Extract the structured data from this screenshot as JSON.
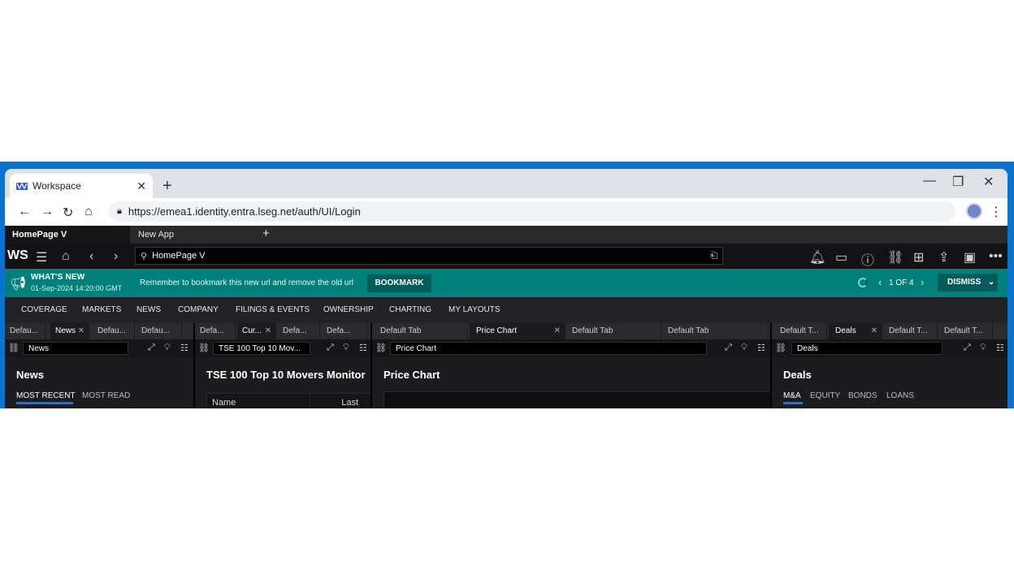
{
  "browser": {
    "tab_title": "Workspace",
    "new_tab": "+",
    "url": "https://emea1.identity.entra.lseg.net/auth/UI/Login",
    "controls": {
      "minimize": "—",
      "restore": "❐",
      "close": "✕"
    }
  },
  "app": {
    "tabs": [
      {
        "label": "HomePage V",
        "active": true
      },
      {
        "label": "New App",
        "active": false
      }
    ],
    "add_tab": "+",
    "logo": "WS",
    "search_value": "HomePage V",
    "banner": {
      "heading": "WHAT'S NEW",
      "datetime": "01-Sep-2024  14:20:00 GMT",
      "message": "Remember to bookmark this new url and remove the old url",
      "bookmark_label": "BOOKMARK",
      "pager": "1 OF 4",
      "dismiss_label": "DISMISS",
      "color": "#007f7b"
    },
    "menu": [
      "COVERAGE",
      "MARKETS",
      "NEWS",
      "COMPANY",
      "FILINGS & EVENTS",
      "OWNERSHIP",
      "CHARTING",
      "MY LAYOUTS"
    ]
  },
  "panes": [
    {
      "tabs": [
        "Defau...",
        "News",
        "Defau...",
        "Defau..."
      ],
      "active_tab": 1,
      "field": "News",
      "title": "News",
      "subtabs": [
        "MOST RECENT",
        "MOST READ"
      ]
    },
    {
      "tabs": [
        "Defa...",
        "Cur...",
        "Defa...",
        "Defa..."
      ],
      "active_tab": 1,
      "field": "TSE 100 Top 10 Mov...",
      "title": "TSE 100 Top 10 Movers Monitor",
      "columns": [
        "Name",
        "Last"
      ]
    },
    {
      "tabs": [
        "Default Tab",
        "Price Chart",
        "Default Tab",
        "Default Tab"
      ],
      "active_tab": 1,
      "field": "Price Chart",
      "title": "Price Chart"
    },
    {
      "tabs": [
        "Default T...",
        "Deals",
        "Default T...",
        "Default T..."
      ],
      "active_tab": 1,
      "field": "Deals",
      "title": "Deals",
      "subtabs": [
        "M&A",
        "EQUITY",
        "BONDS",
        "LOANS"
      ]
    }
  ],
  "accent_color": "#1a73e8"
}
